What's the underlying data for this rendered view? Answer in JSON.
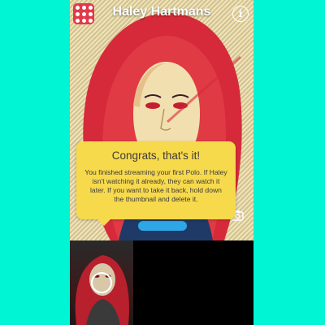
{
  "header": {
    "title": "Haley Hartmans",
    "menu_icon": "grid-menu-icon",
    "info_icon": "info-icon",
    "info_glyph": "i"
  },
  "tooltip": {
    "title": "Congrats, that's it!",
    "body": "You finished streaming your first Polo. If Haley isn't watching it already, they can watch it later. If you want to take it back, hold down the thumbnail and delete it."
  },
  "colors": {
    "background": "#00f5d4",
    "tooltip": "#f7d94c",
    "menu_button": "#e23a4a",
    "send_button": "#2ea7e6"
  }
}
